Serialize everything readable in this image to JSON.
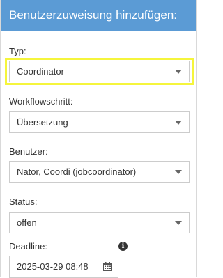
{
  "header": {
    "title": "Benutzerzuweisung hinzufügen:"
  },
  "fields": {
    "type": {
      "label": "Typ:",
      "value": "Coordinator"
    },
    "workflow_step": {
      "label": "Workflowschritt:",
      "value": "Übersetzung"
    },
    "user": {
      "label": "Benutzer:",
      "value": "Nator, Coordi (jobcoordinator)"
    },
    "status": {
      "label": "Status:",
      "value": "offen"
    },
    "deadline": {
      "label": "Deadline:",
      "value": "2025-03-29 08:48",
      "info_icon": "i"
    }
  },
  "icons": {
    "dropdown": "chevron-down-icon",
    "info": "info-icon",
    "calendar": "calendar-icon"
  },
  "colors": {
    "header_background": "#5b9bd5",
    "header_text": "#ffffff",
    "highlight": "#f5f53c"
  }
}
